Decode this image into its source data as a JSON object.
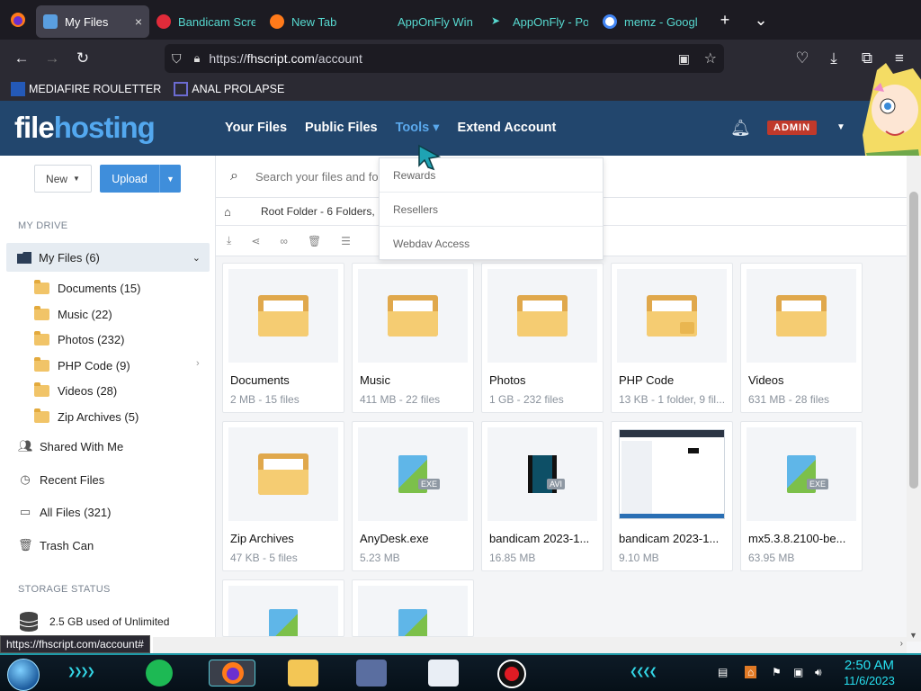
{
  "browser": {
    "tabs": [
      {
        "title": "My Files",
        "active": true,
        "close": "×"
      },
      {
        "title": "Bandicam Scre",
        "active": false
      },
      {
        "title": "New Tab",
        "active": false
      },
      {
        "title": "AppOnFly Win",
        "active": false
      },
      {
        "title": "AppOnFly - Po",
        "active": false
      },
      {
        "title": "memz - Googl",
        "active": false
      }
    ],
    "new_tab": "+",
    "tab_list": "⌄",
    "url_scheme": "https://",
    "url_host": "fhscript.com",
    "url_path": "/account",
    "bookmarks": [
      "MEDIAFIRE ROULETTER",
      "ANAL PROLAPSE"
    ]
  },
  "site": {
    "logo_a": "file",
    "logo_b": "hosting",
    "nav": [
      "Your Files",
      "Public Files",
      "Tools ▾",
      "Extend Account"
    ],
    "admin_badge": "ADMIN",
    "tools_menu": [
      "Rewards",
      "Resellers",
      "Webdav Access"
    ]
  },
  "sidebar": {
    "new_label": "New",
    "upload_label": "Upload",
    "section_drive": "MY DRIVE",
    "my_files": "My Files (6)",
    "folders": [
      "Documents (15)",
      "Music (22)",
      "Photos (232)",
      "PHP Code (9)",
      "Videos (28)",
      "Zip Archives (5)"
    ],
    "nav": [
      "Shared With Me",
      "Recent Files",
      "All Files (321)",
      "Trash Can"
    ],
    "section_storage": "STORAGE STATUS",
    "storage_text": "2.5 GB used of Unlimited"
  },
  "main": {
    "search_placeholder": "Search your files and fo",
    "breadcrumb": "Root Folder - 6 Folders, ",
    "items": [
      {
        "name": "Documents",
        "meta": "2 MB - 15 files",
        "kind": "folder"
      },
      {
        "name": "Music",
        "meta": "411 MB - 22 files",
        "kind": "folder"
      },
      {
        "name": "Photos",
        "meta": "1 GB - 232 files",
        "kind": "folder"
      },
      {
        "name": "PHP Code",
        "meta": "13 KB - 1 folder, 9 fil...",
        "kind": "folder-locked"
      },
      {
        "name": "Videos",
        "meta": "631 MB - 28 files",
        "kind": "folder"
      },
      {
        "name": "Zip Archives",
        "meta": "47 KB - 5 files",
        "kind": "folder"
      },
      {
        "name": "AnyDesk.exe",
        "meta": "5.23 MB",
        "kind": "exe",
        "badge": "EXE"
      },
      {
        "name": "bandicam 2023-1...",
        "meta": "16.85 MB",
        "kind": "avi",
        "badge": "AVI"
      },
      {
        "name": "bandicam 2023-1...",
        "meta": "9.10 MB",
        "kind": "image"
      },
      {
        "name": "mx5.3.8.2100-be...",
        "meta": "63.95 MB",
        "kind": "exe",
        "badge": "EXE"
      }
    ]
  },
  "status_link": "https://fhscript.com/account#",
  "taskbar": {
    "time": "2:50 AM",
    "date": "11/6/2023"
  }
}
